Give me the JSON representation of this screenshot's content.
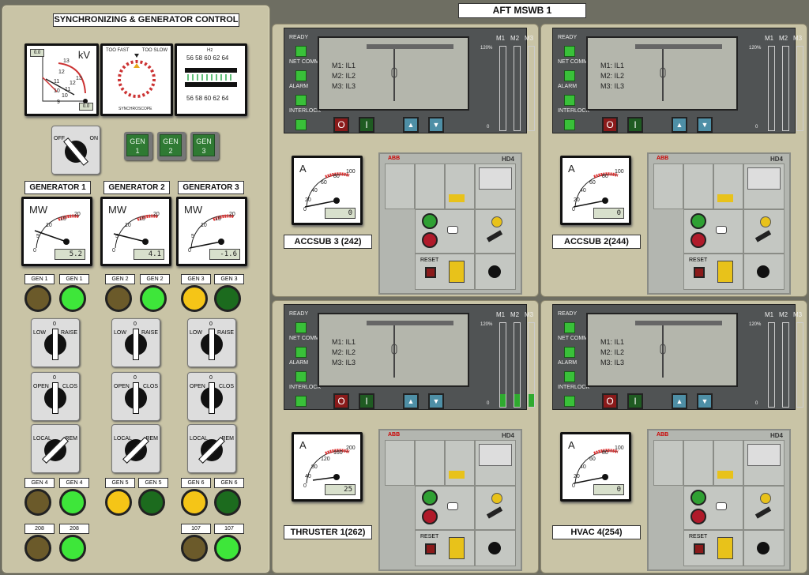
{
  "sync_panel": {
    "title": "SYNCHRONIZING & GENERATOR CONTROL",
    "kv_meter": {
      "unit": "kV",
      "ticks": [
        "13",
        "12",
        "11",
        "10",
        "13",
        "12",
        "11",
        "10",
        "9"
      ],
      "readout_top": "0.0",
      "readout_bottom": "0.0"
    },
    "synchroscope": {
      "too_fast": "TOO FAST",
      "too_slow": "TOO SLOW",
      "name": "SYNCHROSCOPE"
    },
    "hz_meter": {
      "unit": "Hz",
      "scale_top": "56 58 60 62 64",
      "scale_bottom": "56 58 60 62 64"
    },
    "sync_switch": {
      "off": "OFF",
      "on": "ON"
    },
    "gen_buttons": [
      {
        "line1": "GEN",
        "line2": "1"
      },
      {
        "line1": "GEN",
        "line2": "2"
      },
      {
        "line1": "GEN",
        "line2": "3"
      }
    ],
    "generators": [
      {
        "title": "GENERATOR 1",
        "unit": "MW",
        "ticks": [
          "0",
          "5",
          "10",
          "15",
          "20"
        ],
        "readout": "5.2",
        "value": 5.2
      },
      {
        "title": "GENERATOR 2",
        "unit": "MW",
        "ticks": [
          "0",
          "5",
          "10",
          "15",
          "20"
        ],
        "readout": "4.1",
        "value": 4.1
      },
      {
        "title": "GENERATOR 3",
        "unit": "MW",
        "ticks": [
          "0",
          "5",
          "10",
          "15",
          "20"
        ],
        "readout": "-1.6",
        "value": -1.6
      }
    ],
    "lamp_rows": [
      [
        {
          "label": "GEN 1",
          "color": "#6b5a2a"
        },
        {
          "label": "GEN 1",
          "color": "#3ee63a"
        },
        {
          "label": "GEN 2",
          "color": "#6b5a2a"
        },
        {
          "label": "GEN 2",
          "color": "#3ee63a"
        },
        {
          "label": "GEN 3",
          "color": "#f5c517"
        },
        {
          "label": "GEN 3",
          "color": "#1c6b1e"
        }
      ],
      [
        {
          "label": "GEN 4",
          "color": "#6b5a2a"
        },
        {
          "label": "GEN 4",
          "color": "#3ee63a"
        },
        {
          "label": "GEN 5",
          "color": "#f5c517"
        },
        {
          "label": "GEN 5",
          "color": "#1c6b1e"
        },
        {
          "label": "GEN 6",
          "color": "#f5c517"
        },
        {
          "label": "GEN 6",
          "color": "#1c6b1e"
        }
      ],
      [
        {
          "label": "208",
          "color": "#6b5a2a"
        },
        {
          "label": "208",
          "color": "#3ee63a"
        },
        null,
        null,
        {
          "label": "107",
          "color": "#6b5a2a"
        },
        {
          "label": "107",
          "color": "#3ee63a"
        }
      ]
    ],
    "switch_rows": [
      {
        "left": "LOW",
        "center": "0",
        "right": "RAISE"
      },
      {
        "left": "OPEN",
        "center": "0",
        "right": "CLOS"
      },
      {
        "left": "LOCAL",
        "center": "",
        "right": "REM"
      }
    ]
  },
  "mswb": {
    "title": "AFT MSWB 1",
    "relay_labels": {
      "ready": "READY",
      "net_comm": "NET COMM",
      "alarm": "ALARM",
      "interlock": "INTERLOCK"
    },
    "lcd_lines": [
      "M1:  IL1",
      "M2:  IL2",
      "M3:  IL3"
    ],
    "meter_cols": [
      "M1",
      "M2",
      "M3"
    ],
    "scale_top": "120%",
    "scale_bottom": "0",
    "btn_off": "O",
    "btn_on": "I",
    "abb_brand": "ABB",
    "abb_model": "HD4",
    "reset_label": "RESET",
    "feeders": [
      {
        "name": "ACCSUB 3 (242)",
        "unit": "A",
        "ticks": [
          "0",
          "20",
          "40",
          "60",
          "80",
          "100"
        ],
        "readout": "0",
        "bar_fill": [
          0,
          0,
          0
        ]
      },
      {
        "name": "ACCSUB 2(244)",
        "unit": "A",
        "ticks": [
          "0",
          "20",
          "40",
          "60",
          "80",
          "100"
        ],
        "readout": "0",
        "bar_fill": [
          0,
          0,
          0
        ]
      },
      {
        "name": "THRUSTER 1(262)",
        "unit": "A",
        "ticks": [
          "0",
          "40",
          "80",
          "120",
          "160",
          "200"
        ],
        "readout": "25",
        "bar_fill": [
          0.15,
          0.15,
          0.15
        ]
      },
      {
        "name": "HVAC 4(254)",
        "unit": "A",
        "ticks": [
          "0",
          "20",
          "40",
          "60",
          "80",
          "100"
        ],
        "readout": "0",
        "bar_fill": [
          0,
          0,
          0
        ]
      }
    ]
  }
}
